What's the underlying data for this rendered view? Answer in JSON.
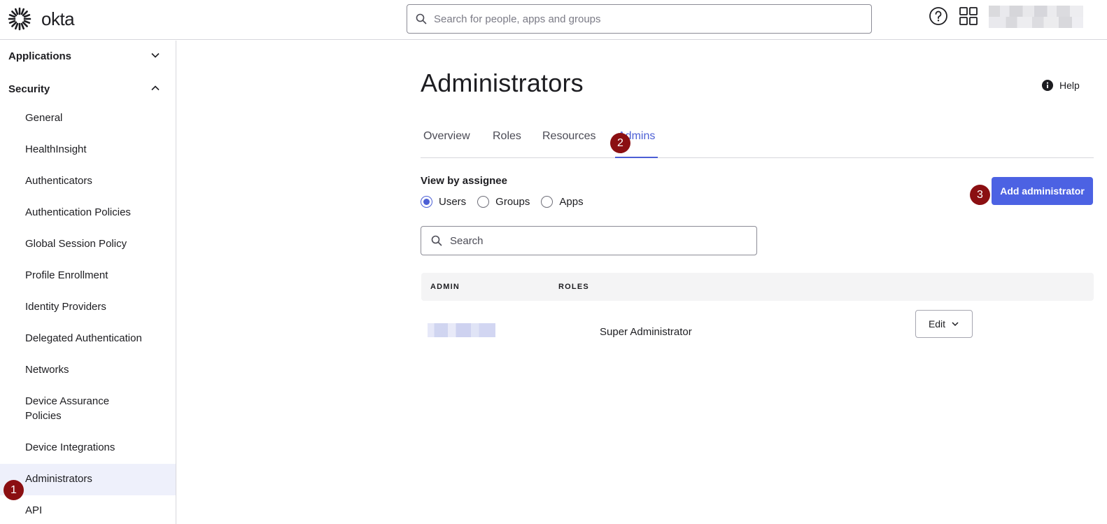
{
  "app": {
    "brand": "okta"
  },
  "topbar": {
    "search_placeholder": "Search for people, apps and groups",
    "help_icon": "question-circle-icon",
    "apps_icon": "grid-icon"
  },
  "sidebar": {
    "sections": [
      {
        "label": "Applications",
        "expanded": false
      },
      {
        "label": "Security",
        "expanded": true
      }
    ],
    "items": [
      {
        "label": "General"
      },
      {
        "label": "HealthInsight"
      },
      {
        "label": "Authenticators"
      },
      {
        "label": "Authentication Policies"
      },
      {
        "label": "Global Session Policy"
      },
      {
        "label": "Profile Enrollment"
      },
      {
        "label": "Identity Providers"
      },
      {
        "label": "Delegated Authentication"
      },
      {
        "label": "Networks"
      },
      {
        "label": "Device Assurance Policies"
      },
      {
        "label": "Device Integrations"
      },
      {
        "label": "Administrators",
        "active": true
      },
      {
        "label": "API"
      }
    ]
  },
  "main": {
    "title": "Administrators",
    "help_label": "Help",
    "tabs": [
      {
        "label": "Overview"
      },
      {
        "label": "Roles"
      },
      {
        "label": "Resources"
      },
      {
        "label": "Admins",
        "active": true
      }
    ],
    "view_by_label": "View by assignee",
    "radios": [
      {
        "label": "Users",
        "checked": true
      },
      {
        "label": "Groups",
        "checked": false
      },
      {
        "label": "Apps",
        "checked": false
      }
    ],
    "add_button_label": "Add administrator",
    "search_placeholder": "Search",
    "table": {
      "columns": [
        "ADMIN",
        "ROLES"
      ],
      "rows": [
        {
          "admin": "",
          "role": "Super Administrator",
          "action": "Edit"
        }
      ]
    }
  },
  "step_badges": [
    "1",
    "2",
    "3"
  ],
  "colors": {
    "accent": "#4c62e3",
    "active_tab": "#4c5fd5",
    "badge": "#8b0f12",
    "active_nav_bg": "#eef0fb"
  }
}
